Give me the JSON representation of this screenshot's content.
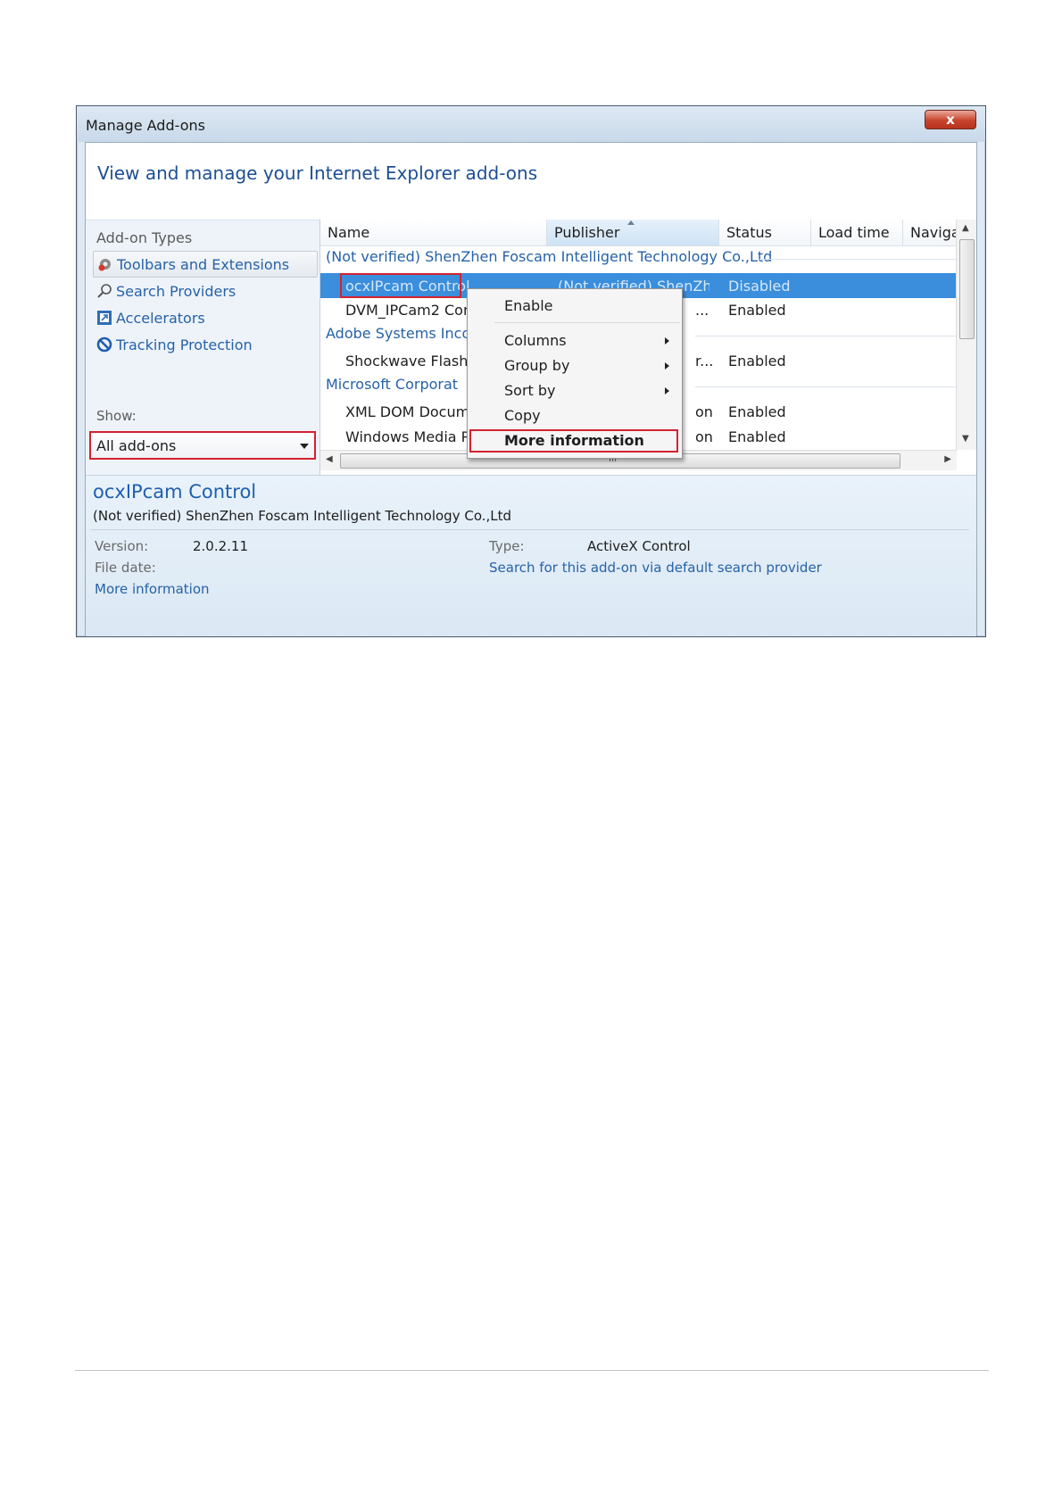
{
  "window": {
    "title": "Manage Add-ons",
    "close_label": "x"
  },
  "heading": "View and manage your Internet Explorer add-ons",
  "sidebar": {
    "caption": "Add-on Types",
    "items": [
      {
        "label": "Toolbars and Extensions",
        "icon": "gear-icon"
      },
      {
        "label": "Search Providers",
        "icon": "search-icon"
      },
      {
        "label": "Accelerators",
        "icon": "accelerator-icon"
      },
      {
        "label": "Tracking Protection",
        "icon": "no-entry-icon"
      }
    ],
    "show_label": "Show:",
    "show_value": "All add-ons"
  },
  "grid": {
    "columns": [
      "Name",
      "Publisher",
      "Status",
      "Load time",
      "Naviga"
    ],
    "groups": [
      "(Not verified) ShenZhen Foscam Intelligent Technology Co.,Ltd",
      "Adobe Systems Inco",
      "Microsoft Corporat"
    ],
    "rows": [
      {
        "name": "ocxIPcam Control",
        "publisher": "(Not verified) ShenZh...",
        "status": "Disabled"
      },
      {
        "name": "DVM_IPCam2 Con",
        "publisher": "...",
        "status": "Enabled"
      },
      {
        "name": "Shockwave Flash C",
        "publisher": "r...",
        "status": "Enabled"
      },
      {
        "name": "XML DOM Docum",
        "publisher": "on",
        "status": "Enabled"
      },
      {
        "name": "Windows Media P",
        "publisher": "on",
        "status": "Enabled"
      }
    ],
    "hscroll_grip": "III"
  },
  "context_menu": {
    "items": [
      "Enable",
      "Columns",
      "Group by",
      "Sort by",
      "Copy",
      "More information"
    ]
  },
  "details": {
    "name": "ocxIPcam Control",
    "publisher": "(Not verified) ShenZhen Foscam Intelligent Technology Co.,Ltd",
    "version_label": "Version:",
    "version_value": "2.0.2.11",
    "filedate_label": "File date:",
    "more_info_link": "More information",
    "type_label": "Type:",
    "type_value": "ActiveX Control",
    "search_link": "Search for this add-on via default search provider"
  }
}
